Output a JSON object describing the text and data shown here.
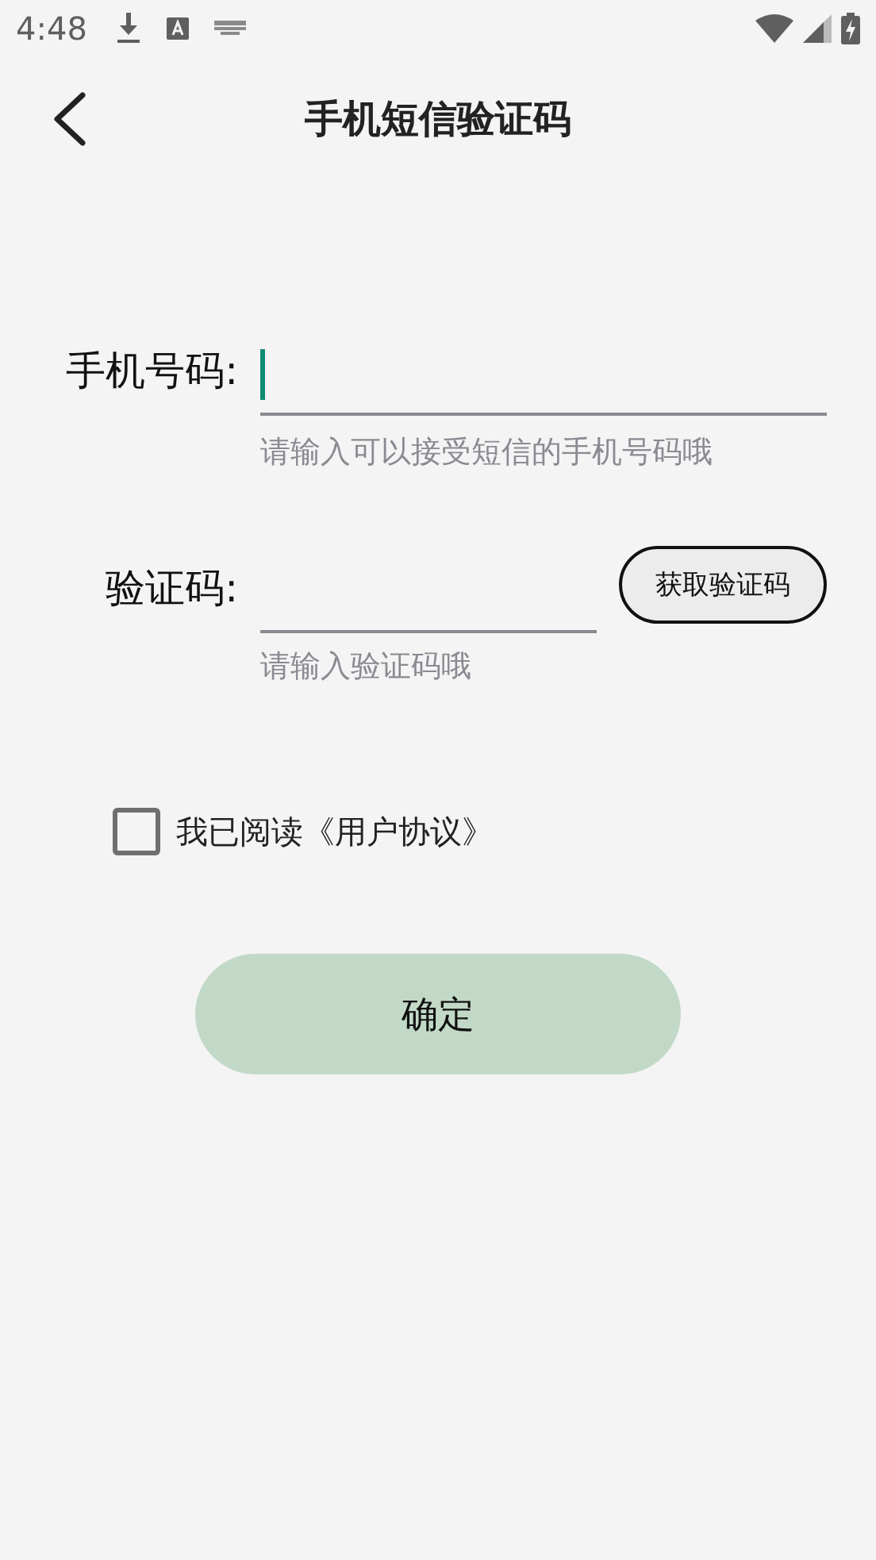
{
  "status_bar": {
    "time": "4:48"
  },
  "header": {
    "title": "手机短信验证码"
  },
  "phone": {
    "label": "手机号码:",
    "focused": true,
    "hint": "请输入可以接受短信的手机号码哦"
  },
  "code": {
    "label": "验证码:",
    "focused": false,
    "hint": "请输入验证码哦",
    "button": "获取验证码"
  },
  "agreement": {
    "label": "我已阅读《用户协议》",
    "checked": false
  },
  "confirm_button": "确定"
}
